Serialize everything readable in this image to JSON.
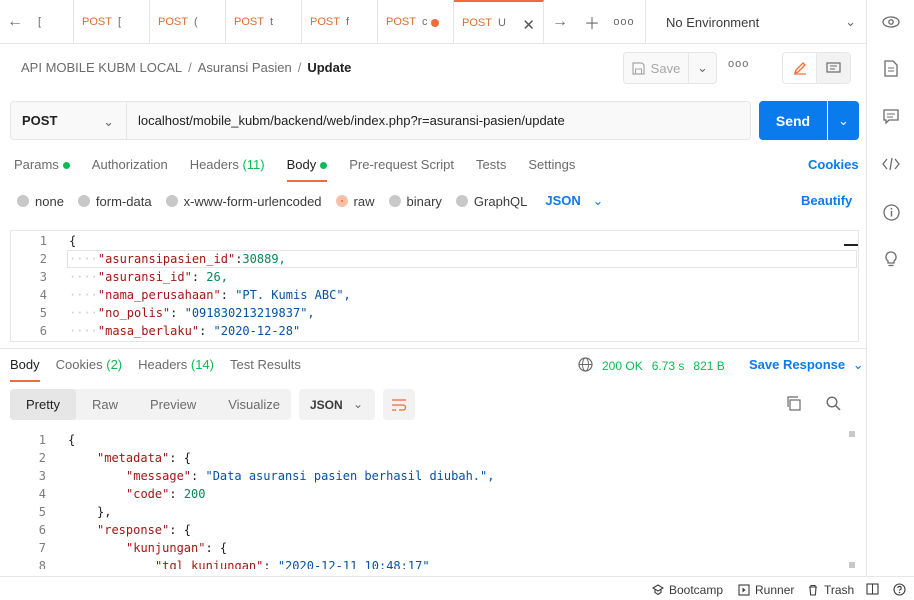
{
  "tabs": [
    {
      "method": "",
      "label": "["
    },
    {
      "method": "POST",
      "label": "["
    },
    {
      "method": "POST",
      "label": "("
    },
    {
      "method": "POST",
      "label": "t"
    },
    {
      "method": "POST",
      "label": "f"
    },
    {
      "method": "POST",
      "label": "c"
    },
    {
      "method": "POST",
      "label": "U"
    }
  ],
  "environment": "No Environment",
  "breadcrumb": {
    "collection": "API MOBILE KUBM LOCAL",
    "folder": "Asuransi Pasien",
    "request": "Update",
    "sep": "/"
  },
  "toolbar": {
    "save_label": "Save",
    "more": "ooo"
  },
  "request": {
    "method": "POST",
    "url": "localhost/mobile_kubm/backend/web/index.php?r=asuransi-pasien/update",
    "send_label": "Send"
  },
  "req_tabs": {
    "params": "Params",
    "authorization": "Authorization",
    "headers": "Headers",
    "headers_count": "(11)",
    "body": "Body",
    "prerequest": "Pre-request Script",
    "tests": "Tests",
    "settings": "Settings",
    "cookies": "Cookies"
  },
  "body_types": {
    "none": "none",
    "form_data": "form-data",
    "urlencoded": "x-www-form-urlencoded",
    "raw": "raw",
    "binary": "binary",
    "graphql": "GraphQL",
    "lang": "JSON",
    "beautify": "Beautify"
  },
  "request_body": {
    "lines": [
      {
        "n": "1",
        "key": "",
        "punct": "{",
        "val": "",
        "type": ""
      },
      {
        "n": "2",
        "key": "\"asuransipasien_id\"",
        "punct": ":",
        "val": "30889,",
        "type": "n"
      },
      {
        "n": "3",
        "key": "\"asuransi_id\"",
        "punct": ": ",
        "val": "26,",
        "type": "n"
      },
      {
        "n": "4",
        "key": "\"nama_perusahaan\"",
        "punct": ": ",
        "val": "\"PT. Kumis ABC\",",
        "type": "s"
      },
      {
        "n": "5",
        "key": "\"no_polis\"",
        "punct": ": ",
        "val": "\"091830213219837\",",
        "type": "s"
      },
      {
        "n": "6",
        "key": "\"masa_berlaku\"",
        "punct": ": ",
        "val": "\"2020-12-28\"",
        "type": "s"
      }
    ]
  },
  "response": {
    "tabs": {
      "body": "Body",
      "cookies": "Cookies",
      "cookies_count": "(2)",
      "headers": "Headers",
      "headers_count": "(14)",
      "tests": "Test Results"
    },
    "status": "200 OK",
    "time": "6.73 s",
    "size": "821 B",
    "save_label": "Save Response",
    "views": {
      "pretty": "Pretty",
      "raw": "Raw",
      "preview": "Preview",
      "visualize": "Visualize"
    },
    "format": "JSON",
    "lines": [
      {
        "n": "1",
        "indent": 0,
        "key": "",
        "punct": "{",
        "val": "",
        "type": ""
      },
      {
        "n": "2",
        "indent": 1,
        "key": "\"metadata\"",
        "punct": ": {",
        "val": "",
        "type": ""
      },
      {
        "n": "3",
        "indent": 2,
        "key": "\"message\"",
        "punct": ": ",
        "val": "\"Data asuransi pasien berhasil diubah.\",",
        "type": "s"
      },
      {
        "n": "4",
        "indent": 2,
        "key": "\"code\"",
        "punct": ": ",
        "val": "200",
        "type": "n"
      },
      {
        "n": "5",
        "indent": 1,
        "key": "",
        "punct": "},",
        "val": "",
        "type": ""
      },
      {
        "n": "6",
        "indent": 1,
        "key": "\"response\"",
        "punct": ": {",
        "val": "",
        "type": ""
      },
      {
        "n": "7",
        "indent": 2,
        "key": "\"kunjungan\"",
        "punct": ": {",
        "val": "",
        "type": ""
      },
      {
        "n": "8",
        "indent": 3,
        "key": "\"tgl_kunjungan\"",
        "punct": ": ",
        "val": "\"2020-12-11 10:48:17\"",
        "type": "s"
      }
    ]
  },
  "statusbar": {
    "bootcamp": "Bootcamp",
    "runner": "Runner",
    "trash": "Trash"
  },
  "colors": {
    "accent": "#f26b3a",
    "primary": "#097bed",
    "success": "#0cbb52"
  }
}
